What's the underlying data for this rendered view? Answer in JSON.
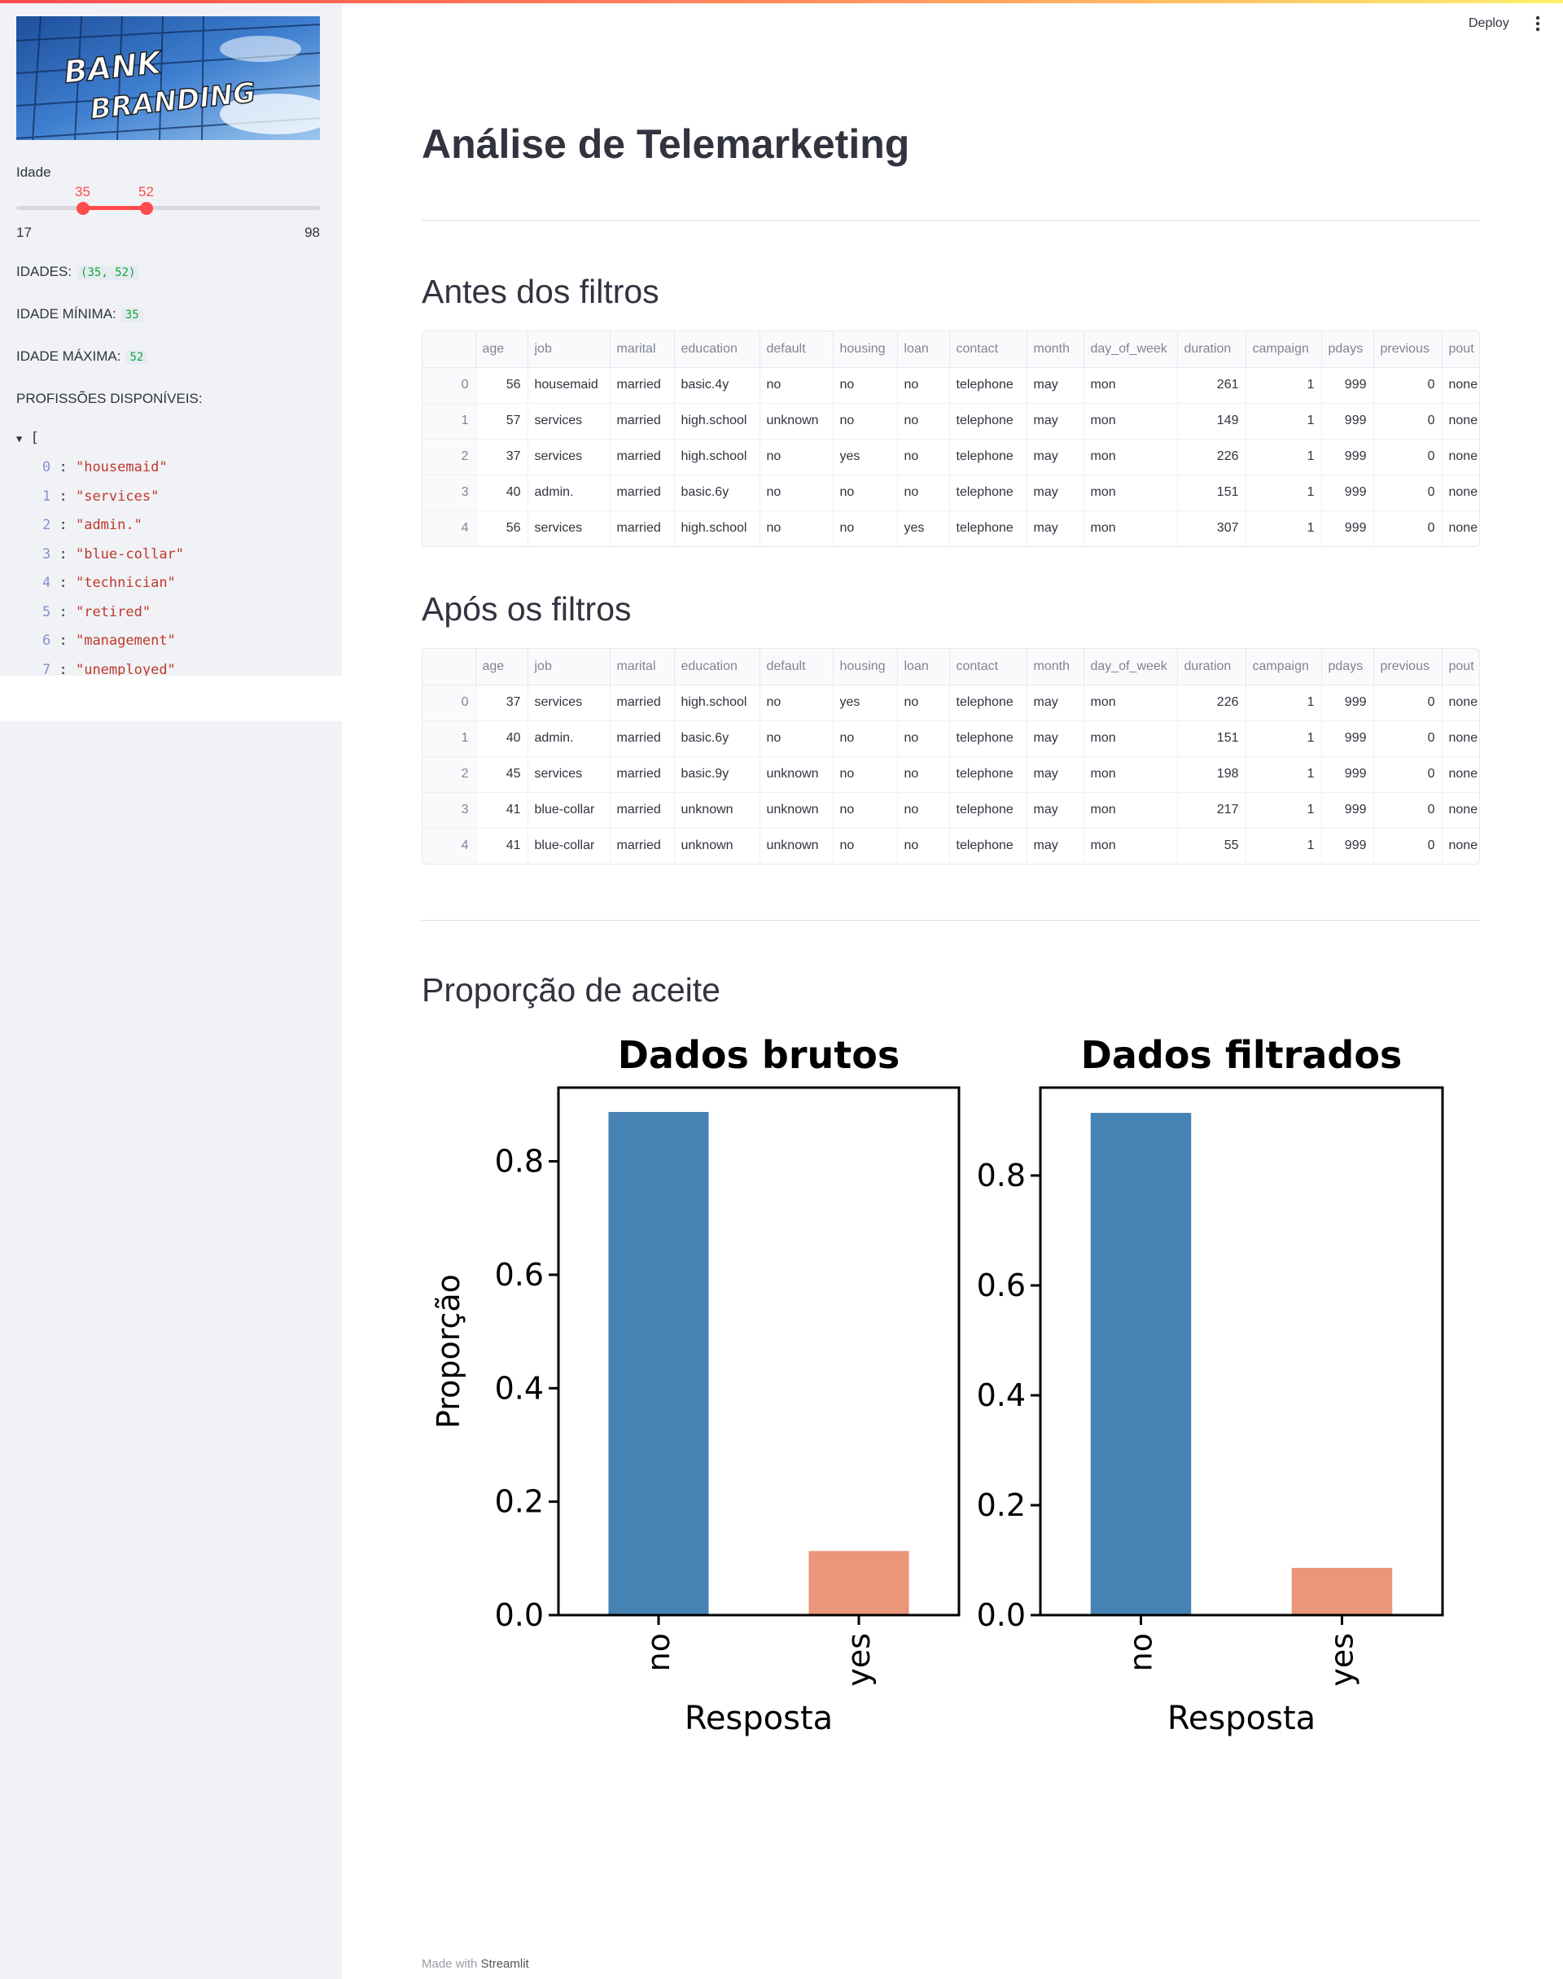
{
  "sidebar": {
    "banner": {
      "line1": "BANK",
      "line2": "BRANDING"
    },
    "slider": {
      "label": "Idade",
      "low": "35",
      "high": "52",
      "min": "17",
      "max": "98"
    },
    "idades_label": "IDADES:",
    "idades_value": "(35, 52)",
    "min_label": "IDADE MÍNIMA:",
    "min_value": "35",
    "max_label": "IDADE MÁXIMA:",
    "max_value": "52",
    "prof_label": "PROFISSÕES DISPONÍVEIS:",
    "json_open": "[",
    "professions": [
      {
        "i": "0",
        "v": "\"housemaid\""
      },
      {
        "i": "1",
        "v": "\"services\""
      },
      {
        "i": "2",
        "v": "\"admin.\""
      },
      {
        "i": "3",
        "v": "\"blue-collar\""
      },
      {
        "i": "4",
        "v": "\"technician\""
      },
      {
        "i": "5",
        "v": "\"retired\""
      },
      {
        "i": "6",
        "v": "\"management\""
      },
      {
        "i": "7",
        "v": "\"unemployed\""
      }
    ]
  },
  "header": {
    "deploy": "Deploy"
  },
  "main": {
    "title": "Análise de Telemarketing",
    "before_title": "Antes dos filtros",
    "after_title": "Após os filtros",
    "chart_title": "Proporção de aceite",
    "columns": [
      "",
      "age",
      "job",
      "marital",
      "education",
      "default",
      "housing",
      "loan",
      "contact",
      "month",
      "day_of_week",
      "duration",
      "campaign",
      "pdays",
      "previous",
      "pout"
    ],
    "before_rows": [
      [
        "0",
        "56",
        "housemaid",
        "married",
        "basic.4y",
        "no",
        "no",
        "no",
        "telephone",
        "may",
        "mon",
        "261",
        "1",
        "999",
        "0",
        "none"
      ],
      [
        "1",
        "57",
        "services",
        "married",
        "high.school",
        "unknown",
        "no",
        "no",
        "telephone",
        "may",
        "mon",
        "149",
        "1",
        "999",
        "0",
        "none"
      ],
      [
        "2",
        "37",
        "services",
        "married",
        "high.school",
        "no",
        "yes",
        "no",
        "telephone",
        "may",
        "mon",
        "226",
        "1",
        "999",
        "0",
        "none"
      ],
      [
        "3",
        "40",
        "admin.",
        "married",
        "basic.6y",
        "no",
        "no",
        "no",
        "telephone",
        "may",
        "mon",
        "151",
        "1",
        "999",
        "0",
        "none"
      ],
      [
        "4",
        "56",
        "services",
        "married",
        "high.school",
        "no",
        "no",
        "yes",
        "telephone",
        "may",
        "mon",
        "307",
        "1",
        "999",
        "0",
        "none"
      ]
    ],
    "after_rows": [
      [
        "0",
        "37",
        "services",
        "married",
        "high.school",
        "no",
        "yes",
        "no",
        "telephone",
        "may",
        "mon",
        "226",
        "1",
        "999",
        "0",
        "none"
      ],
      [
        "1",
        "40",
        "admin.",
        "married",
        "basic.6y",
        "no",
        "no",
        "no",
        "telephone",
        "may",
        "mon",
        "151",
        "1",
        "999",
        "0",
        "none"
      ],
      [
        "2",
        "45",
        "services",
        "married",
        "basic.9y",
        "unknown",
        "no",
        "no",
        "telephone",
        "may",
        "mon",
        "198",
        "1",
        "999",
        "0",
        "none"
      ],
      [
        "3",
        "41",
        "blue-collar",
        "married",
        "unknown",
        "unknown",
        "no",
        "no",
        "telephone",
        "may",
        "mon",
        "217",
        "1",
        "999",
        "0",
        "none"
      ],
      [
        "4",
        "41",
        "blue-collar",
        "married",
        "unknown",
        "unknown",
        "no",
        "no",
        "telephone",
        "may",
        "mon",
        "55",
        "1",
        "999",
        "0",
        "none"
      ]
    ]
  },
  "footer": {
    "prefix": "Made with",
    "brand": "Streamlit"
  },
  "colors": {
    "accent": "#ff4b4b",
    "bar_no": "#4682b4",
    "bar_yes": "#e9967a"
  },
  "chart_data": [
    {
      "type": "bar",
      "title": "Dados brutos",
      "xlabel": "Resposta",
      "ylabel": "Proporção",
      "categories": [
        "no",
        "yes"
      ],
      "values": [
        0.887,
        0.113
      ],
      "ylim": [
        0,
        0.93
      ],
      "yticks": [
        "0.0",
        "0.2",
        "0.4",
        "0.6",
        "0.8"
      ]
    },
    {
      "type": "bar",
      "title": "Dados filtrados",
      "xlabel": "Resposta",
      "ylabel": "",
      "categories": [
        "no",
        "yes"
      ],
      "values": [
        0.914,
        0.086
      ],
      "ylim": [
        0,
        0.96
      ],
      "yticks": [
        "0.0",
        "0.2",
        "0.4",
        "0.6",
        "0.8"
      ]
    }
  ]
}
